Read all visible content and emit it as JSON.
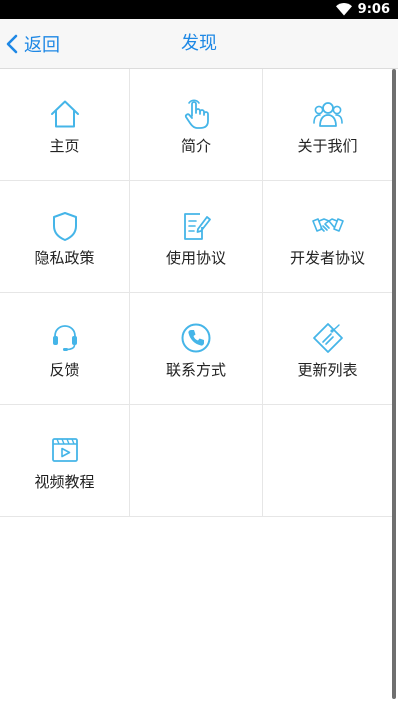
{
  "status_bar": {
    "time": "9:06",
    "wifi_icon": "wifi-icon"
  },
  "header": {
    "back_label": "返回",
    "title": "发现"
  },
  "colors": {
    "accent": "#1e88e5",
    "icon": "#45b5e8"
  },
  "grid": {
    "rows": [
      [
        {
          "label": "主页",
          "icon": "home-icon"
        },
        {
          "label": "简介",
          "icon": "pointer-hand-icon"
        },
        {
          "label": "关于我们",
          "icon": "team-icon"
        }
      ],
      [
        {
          "label": "隐私政策",
          "icon": "shield-icon"
        },
        {
          "label": "使用协议",
          "icon": "edit-document-icon"
        },
        {
          "label": "开发者协议",
          "icon": "handshake-icon"
        }
      ],
      [
        {
          "label": "反馈",
          "icon": "headset-icon"
        },
        {
          "label": "联系方式",
          "icon": "phone-icon"
        },
        {
          "label": "更新列表",
          "icon": "tag-icon"
        }
      ],
      [
        {
          "label": "视频教程",
          "icon": "video-icon"
        }
      ]
    ]
  }
}
